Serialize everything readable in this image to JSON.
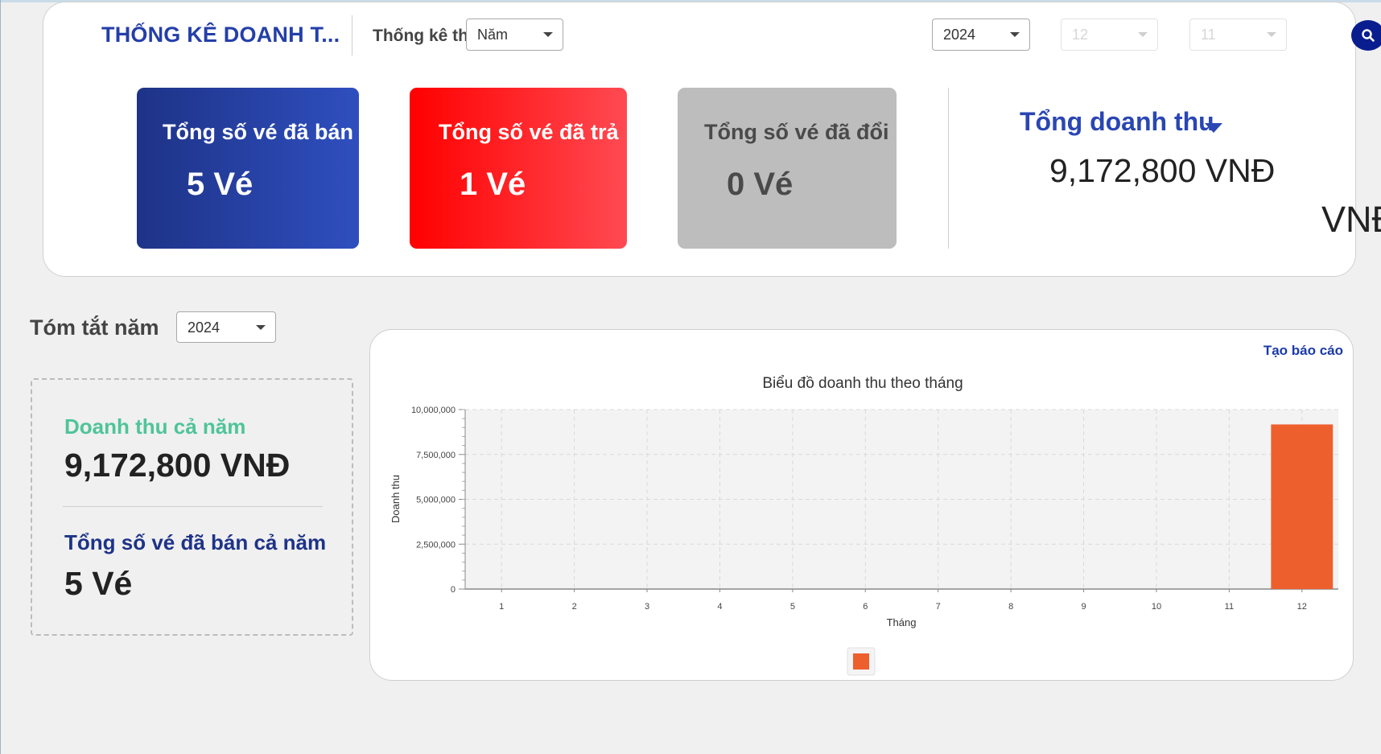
{
  "header": {
    "title": "THỐNG KÊ DOANH T...",
    "subtitle": "Thống kê th...",
    "period_select": "Năm",
    "year_select": "2024",
    "month_select": "12",
    "day_select": "11",
    "search_icon": "search-icon"
  },
  "cards": {
    "sold": {
      "label": "Tổng số vé đã bán",
      "value": "5 Vé",
      "color": "#2a46b3"
    },
    "returned": {
      "label": "Tổng số vé đã trả",
      "value": "1 Vé",
      "color": "#ff1a1a"
    },
    "exchanged": {
      "label": "Tổng số vé đã đổi",
      "value": "0 Vé",
      "color": "#bdbdbd"
    }
  },
  "revenue": {
    "title": "Tổng doanh thu",
    "value": "9,172,800 VNĐ",
    "unit": "VNĐ"
  },
  "summary": {
    "label": "Tóm tắt năm",
    "year": "2024",
    "revenue_label": "Doanh thu cả năm",
    "revenue_value": "9,172,800 VNĐ",
    "tickets_label": "Tổng số vé đã bán cả năm",
    "tickets_value": "5 Vé"
  },
  "report_link": "Tạo báo cáo",
  "chart_data": {
    "type": "bar",
    "title": "Biểu đồ doanh thu theo tháng",
    "xlabel": "Tháng",
    "ylabel": "Doanh thu",
    "categories": [
      "1",
      "2",
      "3",
      "4",
      "5",
      "6",
      "7",
      "8",
      "9",
      "10",
      "11",
      "12"
    ],
    "values": [
      0,
      0,
      0,
      0,
      0,
      0,
      0,
      0,
      0,
      0,
      0,
      9172800
    ],
    "ylim": [
      0,
      10000000
    ],
    "yticks": [
      "0",
      "2,500,000",
      "5,000,000",
      "7,500,000",
      "10,000,000"
    ],
    "grid": true,
    "bar_color": "#ee5f2e",
    "legend": "bottom"
  }
}
